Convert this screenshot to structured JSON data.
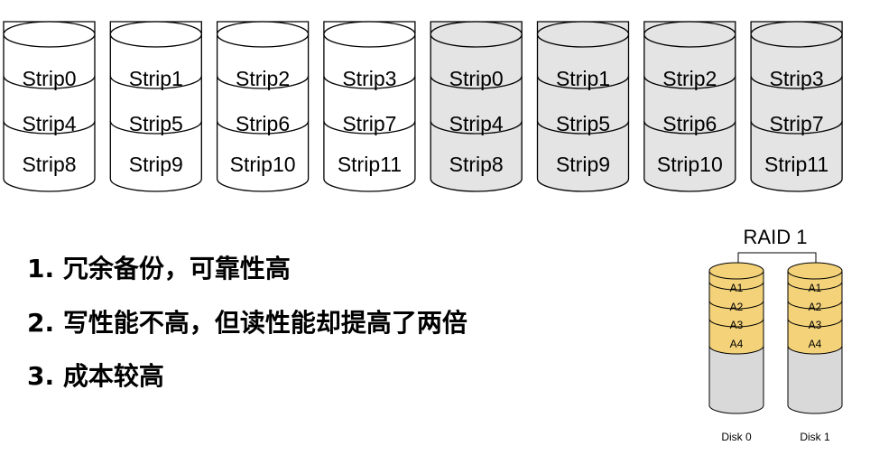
{
  "colors": {
    "disk_white": "#ffffff",
    "disk_gray": "#e4e4e4",
    "raid_gold": "#f3d27a",
    "raid_gray": "#d9d9d9",
    "stroke": "#000000"
  },
  "raid0_disks": [
    {
      "shade": "white",
      "strips": [
        "Strip0",
        "Strip4",
        "Strip8"
      ]
    },
    {
      "shade": "white",
      "strips": [
        "Strip1",
        "Strip5",
        "Strip9"
      ]
    },
    {
      "shade": "white",
      "strips": [
        "Strip2",
        "Strip6",
        "Strip10"
      ]
    },
    {
      "shade": "white",
      "strips": [
        "Strip3",
        "Strip7",
        "Strip11"
      ]
    },
    {
      "shade": "gray",
      "strips": [
        "Strip0",
        "Strip4",
        "Strip8"
      ]
    },
    {
      "shade": "gray",
      "strips": [
        "Strip1",
        "Strip5",
        "Strip9"
      ]
    },
    {
      "shade": "gray",
      "strips": [
        "Strip2",
        "Strip6",
        "Strip10"
      ]
    },
    {
      "shade": "gray",
      "strips": [
        "Strip3",
        "Strip7",
        "Strip11"
      ]
    }
  ],
  "points": [
    "1. 冗余备份，可靠性高",
    "2. 写性能不高，但读性能却提高了两倍",
    "3. 成本较高"
  ],
  "raid1": {
    "title": "RAID 1",
    "disks": [
      {
        "label": "Disk 0",
        "blocks": [
          "A1",
          "A2",
          "A3",
          "A4"
        ]
      },
      {
        "label": "Disk 1",
        "blocks": [
          "A1",
          "A2",
          "A3",
          "A4"
        ]
      }
    ]
  }
}
